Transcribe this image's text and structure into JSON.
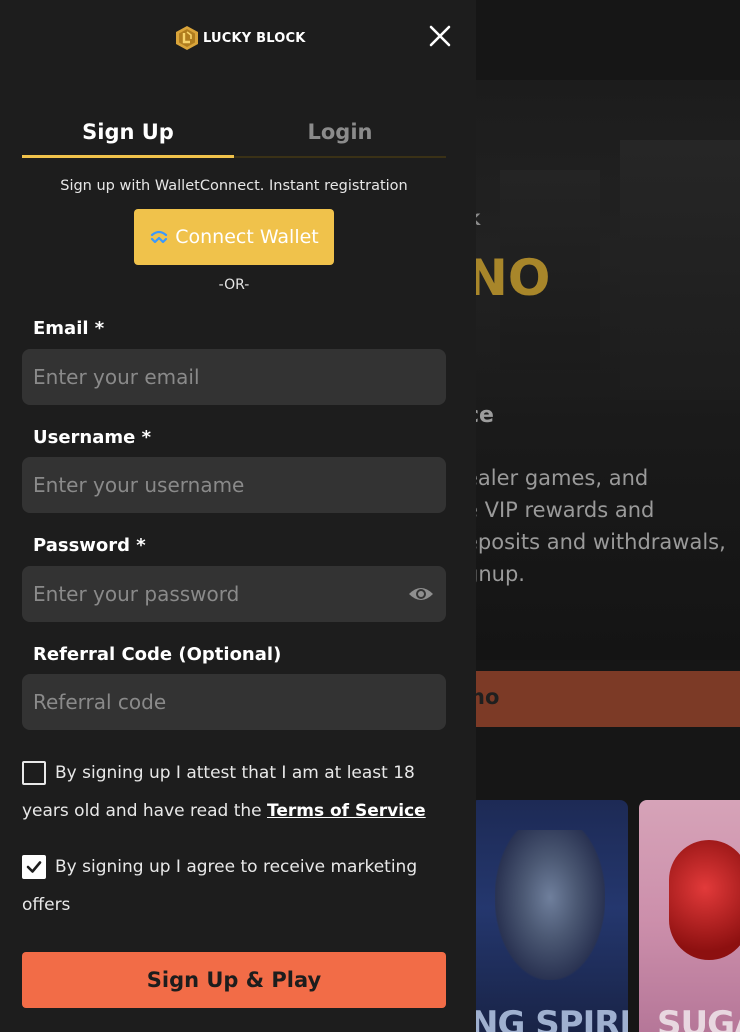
{
  "background": {
    "kicker": "K",
    "title": "NO",
    "subtitle": "ce",
    "body_lines": [
      "ealer games, and",
      "e VIP rewards and",
      "eposits and withdrawals,",
      "gnup."
    ],
    "cta_label": "no",
    "game_cards": [
      {
        "title": "NG SPIRIT"
      },
      {
        "title": "SUGA"
      }
    ]
  },
  "logo": {
    "text": "LUCKY BLOCK"
  },
  "tabs": [
    {
      "label": "Sign Up",
      "active": true
    },
    {
      "label": "Login",
      "active": false
    }
  ],
  "wallet": {
    "intro": "Sign up with WalletConnect. Instant registration",
    "button_label": "Connect Wallet",
    "separator": "-OR-"
  },
  "form": {
    "email": {
      "label": "Email *",
      "placeholder": "Enter your email"
    },
    "username": {
      "label": "Username *",
      "placeholder": "Enter your username"
    },
    "password": {
      "label": "Password *",
      "placeholder": "Enter your password"
    },
    "referral": {
      "label": "Referral Code (Optional)",
      "placeholder": "Referral code"
    }
  },
  "consents": {
    "age": {
      "checked": false,
      "text": "By signing up I attest that I am at least 18 years old and have read the",
      "link": "Terms of Service"
    },
    "marketing": {
      "checked": true,
      "text": "By signing up I agree to receive marketing offers"
    }
  },
  "submit_label": "Sign Up & Play",
  "colors": {
    "accent": "#f0c24b",
    "submit": "#f26c47",
    "panel": "#1d1d1d",
    "input": "#333333"
  }
}
